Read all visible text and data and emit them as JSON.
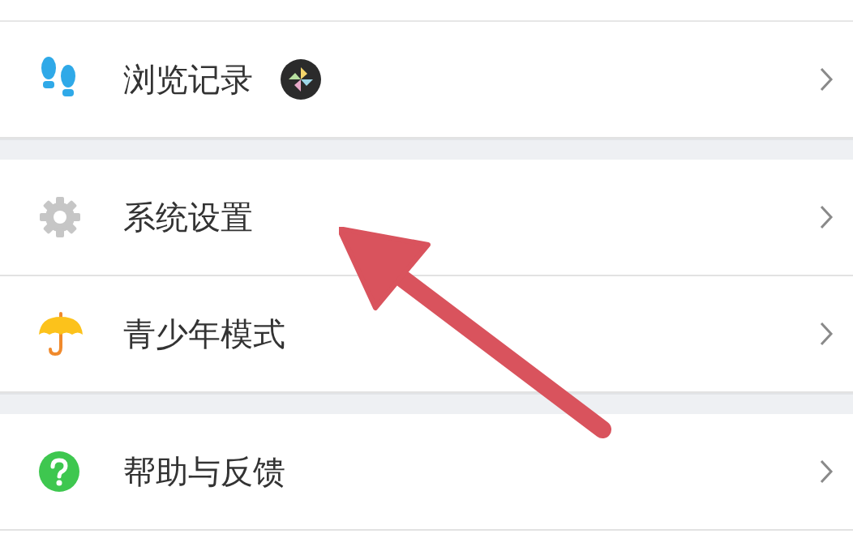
{
  "groups": [
    {
      "items": [
        {
          "kind": "footprints",
          "label": "浏览记录",
          "badge": true
        }
      ]
    },
    {
      "items": [
        {
          "kind": "gear",
          "label": "系统设置",
          "badge": false
        },
        {
          "kind": "umbrella",
          "label": "青少年模式",
          "badge": false
        }
      ]
    },
    {
      "items": [
        {
          "kind": "help",
          "label": "帮助与反馈",
          "badge": false
        }
      ]
    }
  ]
}
